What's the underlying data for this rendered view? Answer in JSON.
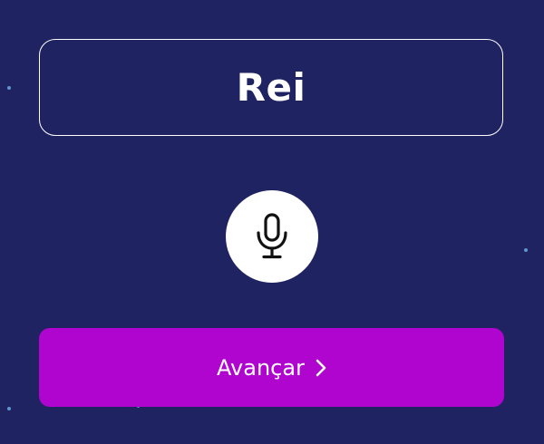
{
  "word_card": {
    "word": "Rei"
  },
  "microphone": {
    "icon": "microphone-icon"
  },
  "next_button": {
    "label": "Avançar",
    "icon": "chevron-right-icon"
  },
  "colors": {
    "background": "#202362",
    "accent": "#b004cf",
    "card_border": "#ffffff",
    "star_dot": "#5f95cf"
  }
}
